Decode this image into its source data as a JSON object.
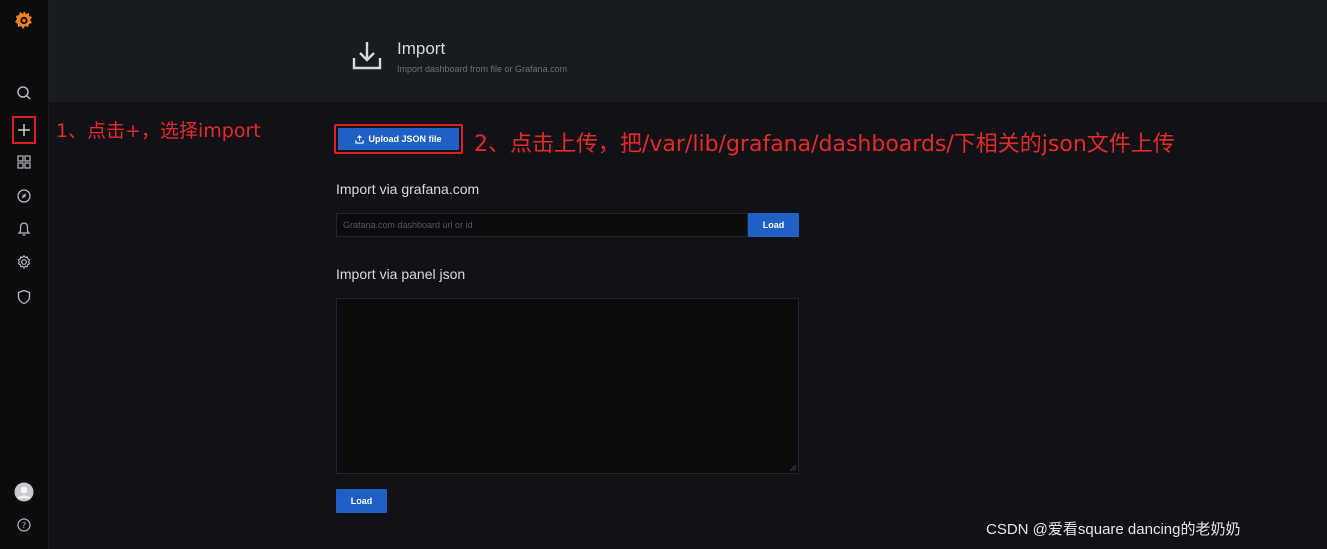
{
  "header": {
    "title": "Import",
    "subtitle": "Import dashboard from file or Grafana.com"
  },
  "sidebar": {
    "icons": [
      "grafana-logo-icon",
      "search-icon",
      "plus-icon",
      "dashboards-icon",
      "explore-icon",
      "alerting-icon",
      "configuration-icon",
      "server-admin-icon",
      "avatar-icon",
      "help-icon"
    ]
  },
  "annotations": {
    "step1": "1、点击+，选择import",
    "step2": "2、点击上传，把/var/lib/grafana/dashboards/下相关的json文件上传"
  },
  "upload": {
    "label": "Upload JSON file"
  },
  "grafana_com": {
    "title": "Import via grafana.com",
    "placeholder": "Grafana.com dashboard url or id",
    "load_label": "Load"
  },
  "panel_json": {
    "title": "Import via panel json",
    "value": "",
    "load_label": "Load"
  },
  "watermark": "CSDN @爱看square dancing的老奶奶",
  "colors": {
    "accent": "#1f60c4",
    "annotation": "#e52a2a",
    "logo": "#f5821f"
  }
}
